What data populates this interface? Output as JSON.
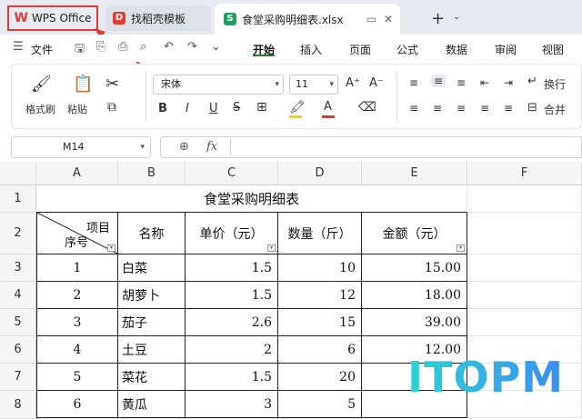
{
  "tabs": {
    "wps": "WPS Office",
    "template": "找稻壳模板",
    "file": "食堂采购明细表.xlsx"
  },
  "menu": {
    "file": "文件",
    "items": [
      "开始",
      "插入",
      "页面",
      "公式",
      "数据",
      "审阅",
      "视图"
    ]
  },
  "ribbon": {
    "format_painter": "格式刷",
    "paste": "粘贴",
    "font_name": "宋体",
    "font_size": "11",
    "bold": "B",
    "italic": "I",
    "underline": "U",
    "font_color_glyph": "A",
    "wrap": "换行",
    "merge": "合并"
  },
  "formula_bar": {
    "cell_ref": "M14",
    "fx": "fx",
    "content": ""
  },
  "sheet": {
    "columns": [
      "A",
      "B",
      "C",
      "D",
      "E",
      "F"
    ],
    "rows": [
      "1",
      "2",
      "3",
      "4",
      "5",
      "6",
      "7",
      "8"
    ],
    "title": "食堂采购明细表",
    "header": {
      "diag_top": "项目",
      "diag_bottom": "序号",
      "name": "名称",
      "price": "单价（元）",
      "qty": "数量（斤）",
      "amount": "金额（元）"
    },
    "data": [
      {
        "no": "1",
        "name": "白菜",
        "price": "1.5",
        "qty": "10",
        "amount": "15.00"
      },
      {
        "no": "2",
        "name": "胡萝卜",
        "price": "1.5",
        "qty": "12",
        "amount": "18.00"
      },
      {
        "no": "3",
        "name": "茄子",
        "price": "2.6",
        "qty": "15",
        "amount": "39.00"
      },
      {
        "no": "4",
        "name": "土豆",
        "price": "2",
        "qty": "6",
        "amount": "12.00"
      },
      {
        "no": "5",
        "name": "菜花",
        "price": "1.5",
        "qty": "20",
        "amount": ""
      },
      {
        "no": "6",
        "name": "黄瓜",
        "price": "3",
        "qty": "5",
        "amount": ""
      }
    ]
  },
  "watermark": "ITOPM"
}
